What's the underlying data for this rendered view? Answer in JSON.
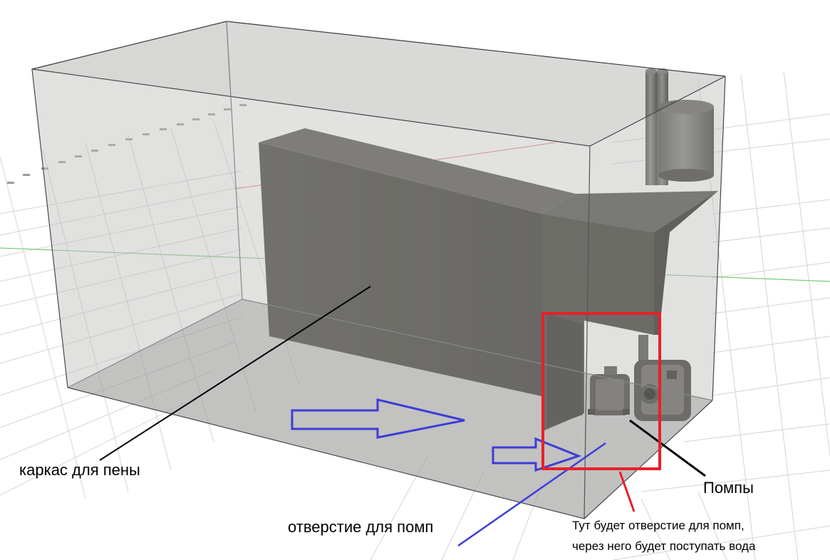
{
  "labels": {
    "foam_frame": "каркас для пены",
    "pump_opening": "отверстие для помп",
    "pumps": "Помпы",
    "note_line1": "Тут будет отверстие для помп,",
    "note_line2": "через него будет поступать вода"
  },
  "colors": {
    "annotation_frame": "#e8202a",
    "flow_arrows": "#3c3cd8",
    "leader_lines": "#000000",
    "grid_axis_red": "#e07070",
    "grid_axis_green": "#5cc05c",
    "housing_dark": "#5b5a55"
  },
  "icons": [
    "red-annotation-box",
    "blue-flow-arrow",
    "leader-line"
  ]
}
